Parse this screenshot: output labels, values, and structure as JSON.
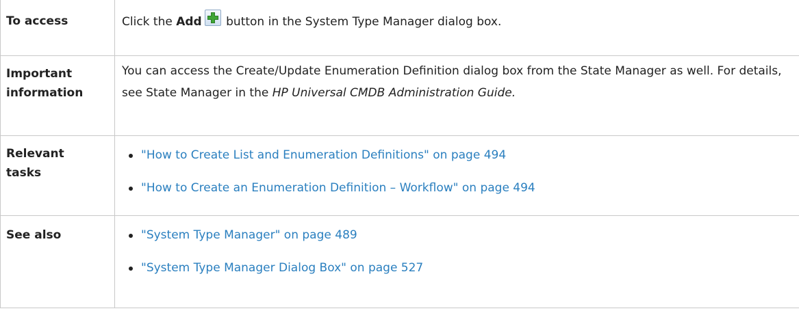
{
  "rows": {
    "access": {
      "heading": "To access",
      "text_before": "Click the ",
      "bold_word": "Add",
      "text_after": " button in the System Type Manager dialog box.",
      "icon": "add-plus-icon"
    },
    "important": {
      "heading_line1": "Important",
      "heading_line2": "information",
      "text_main": "You can access the Create/Update Enumeration Definition dialog box from the State Manager as well. For details, see State Manager in the ",
      "text_italic": "HP Universal CMDB Administration Guide."
    },
    "relevant": {
      "heading_line1": "Relevant",
      "heading_line2": "tasks",
      "links": [
        "\"How to Create List and Enumeration Definitions\" on page 494",
        "\"How to Create an Enumeration Definition – Workflow\" on page 494"
      ]
    },
    "seealso": {
      "heading": "See also",
      "links": [
        "\"System Type Manager\" on page 489",
        "\"System Type Manager Dialog Box\" on page 527"
      ]
    }
  },
  "colors": {
    "link": "#2a7fbf",
    "text": "#222222",
    "border": "#c8c8c8",
    "icon_plus": "#3fa535"
  }
}
